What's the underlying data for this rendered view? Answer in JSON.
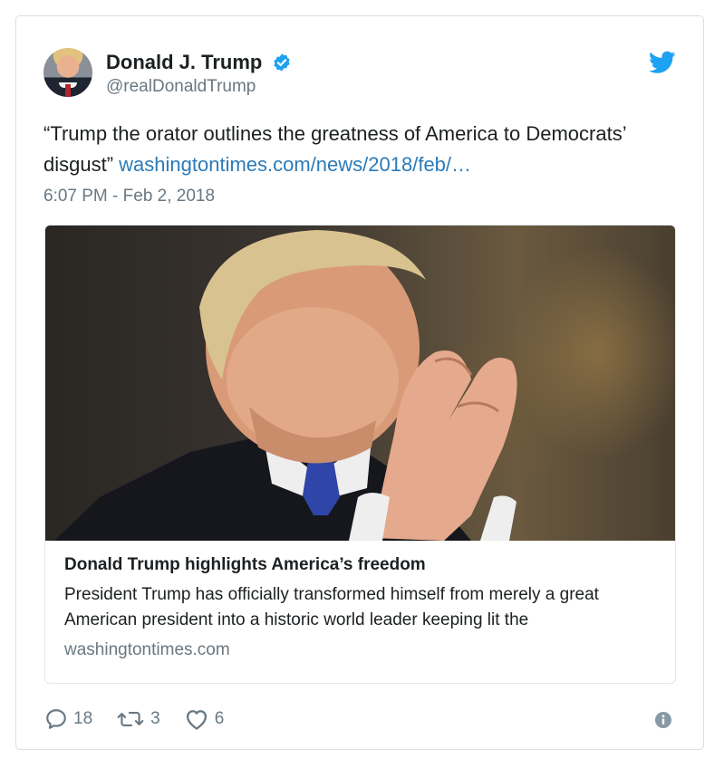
{
  "user": {
    "display_name": "Donald J. Trump",
    "handle": "@realDonaldTrump",
    "verified_icon": "verified-badge-icon",
    "avatar": "profile-photo"
  },
  "tweet": {
    "text": "“Trump the orator outlines the greatness of America to Democrats’ disgust” ",
    "link_text": "washingtontimes.com/news/2018/feb/…",
    "timestamp": "6:07 PM - Feb 2, 2018"
  },
  "card": {
    "title": "Donald Trump highlights America’s freedom",
    "description": "President Trump has officially transformed himself from merely a great American president into a historic world leader keeping lit the",
    "domain": "washingtontimes.com"
  },
  "actions": {
    "replies": "18",
    "retweets": "3",
    "likes": "6"
  },
  "colors": {
    "link": "#2b7bb9",
    "twitter_blue": "#1da1f2",
    "muted": "#697882",
    "text": "#1c2022"
  },
  "icons": {
    "brand": "twitter-bird-icon",
    "reply": "reply-icon",
    "retweet": "retweet-icon",
    "like": "heart-icon",
    "info": "info-icon"
  }
}
